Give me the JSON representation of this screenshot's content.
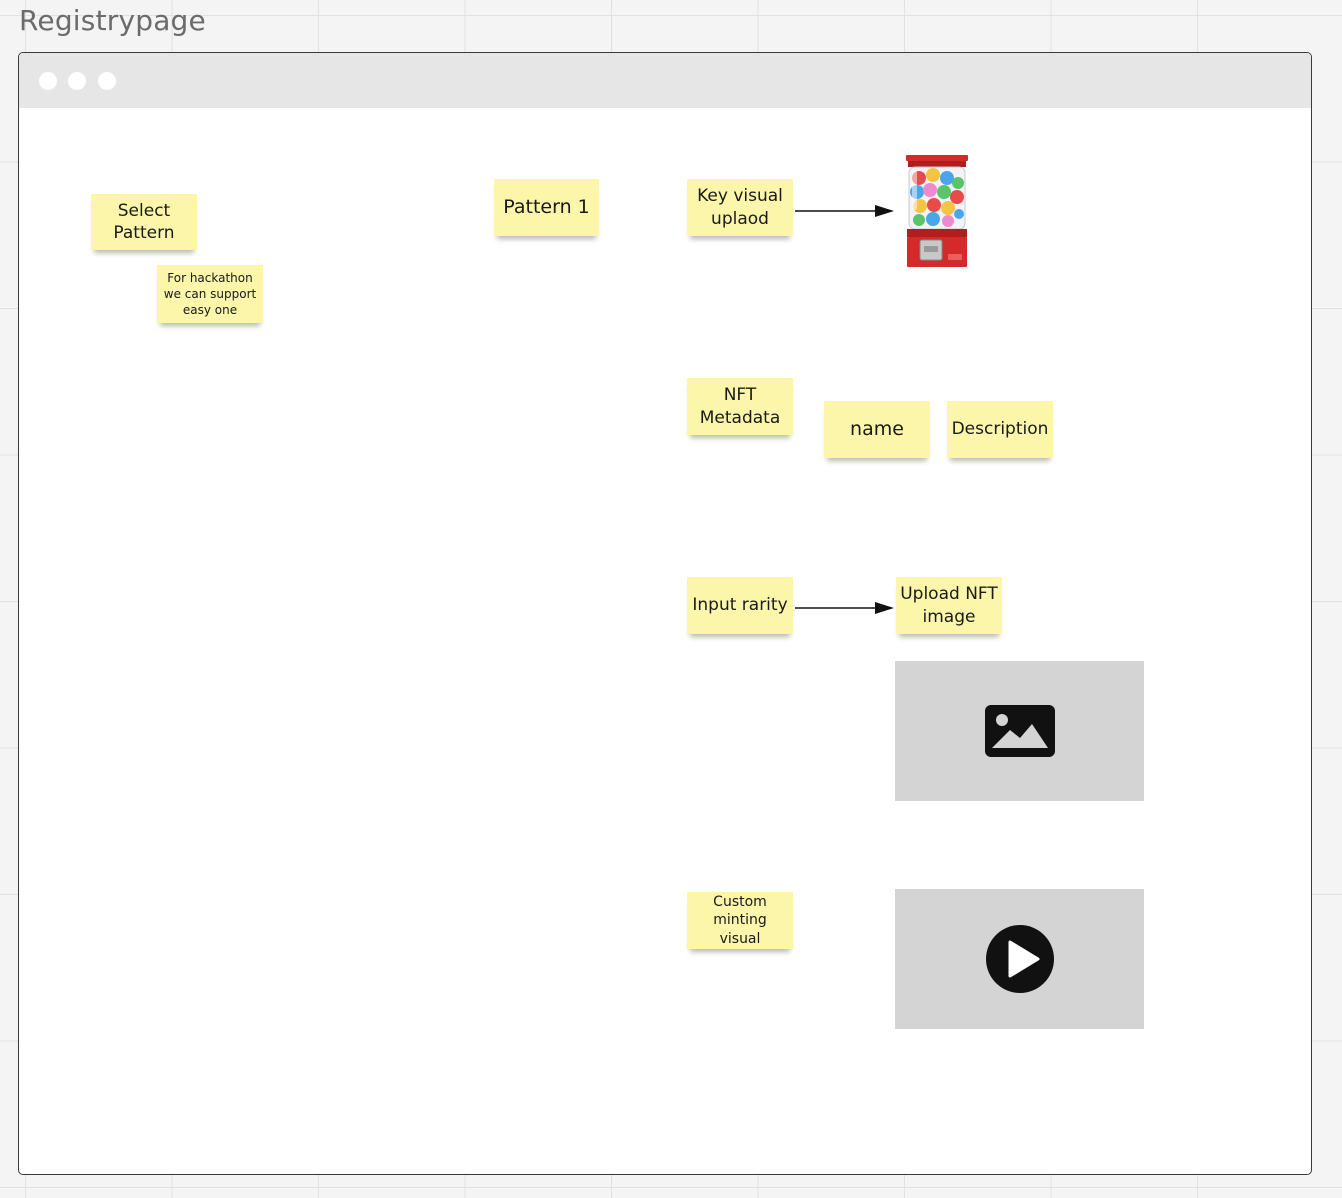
{
  "frame": {
    "title": "Registrypage"
  },
  "notes": {
    "select_pattern": "Select Pattern",
    "hackathon_note": "For hackathon we can support easy one",
    "pattern_1": "Pattern 1",
    "key_visual_upload": "Key visual uplaod",
    "nft_metadata": "NFT Metadata",
    "name": "name",
    "description": "Description",
    "input_rarity": "Input rarity",
    "upload_nft_image": "Upload NFT image",
    "custom_minting_visual": "Custom minting visual"
  },
  "icons": {
    "key_visual": "gumball-machine-icon",
    "image_placeholder": "image-icon",
    "video_placeholder": "play-icon"
  },
  "colors": {
    "sticky_note": "#fbf6a9",
    "placeholder": "#d4d4d4",
    "browser_bar": "#e6e6e6"
  }
}
